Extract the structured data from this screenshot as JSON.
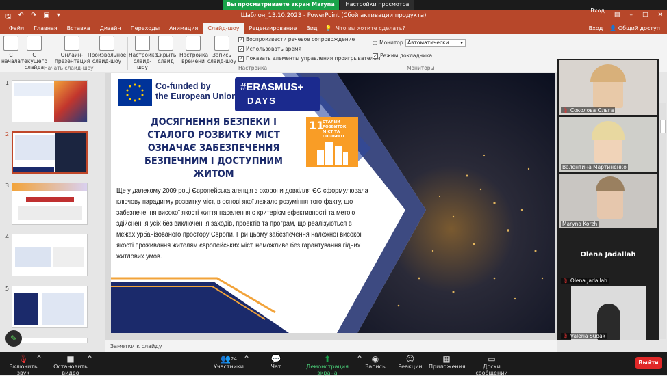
{
  "zoom_top": {
    "share_banner": "Вы просматриваете экран Maryna Korzh",
    "view_settings": "Настройки просмотра"
  },
  "titlebar": {
    "title": "Шаблон_13.10.2023 - PowerPoint (Сбой активации продукта)",
    "signin": "Вход"
  },
  "ribbon_tabs": [
    "Файл",
    "Главная",
    "Вставка",
    "Дизайн",
    "Переходы",
    "Анимация",
    "Слайд-шоу",
    "Рецензирование",
    "Вид"
  ],
  "active_tab": "Слайд-шоу",
  "tell_me": "Что вы хотите сделать?",
  "ribbon_right": {
    "login": "Вход",
    "share": "Общий доступ"
  },
  "ribbon": {
    "start_group": {
      "label": "Начать слайд-шоу",
      "buttons": [
        "С начала",
        "С текущего слайда",
        "Онлайн-презентация",
        "Произвольное слайд-шоу"
      ]
    },
    "setup_group": {
      "label": "Настройка",
      "buttons": [
        "Настройка слайд-шоу",
        "Скрыть слайд",
        "Настройка времени",
        "Запись слайд-шоу"
      ],
      "checks": [
        {
          "label": "Воспроизвести речевое сопровождение",
          "checked": true
        },
        {
          "label": "Использовать время",
          "checked": true
        },
        {
          "label": "Показать элементы управления проигрывателем",
          "checked": true
        }
      ]
    },
    "monitors_group": {
      "label": "Мониторы",
      "monitor_label": "Монитор:",
      "monitor_value": "Автоматически",
      "presenter_view": "Режим докладчика"
    }
  },
  "slide_numbers": [
    "1",
    "2",
    "3",
    "4",
    "5"
  ],
  "selected_slide": 2,
  "slide": {
    "eu_line1": "Co-funded by",
    "eu_line2": "the European Union",
    "erasmus": "#ERASMUS+",
    "days": "DAYS",
    "sdg_num": "11",
    "sdg_text": "СТАЛИЙ РОЗВИТОК МІСТ ТА СПІЛЬНОТ",
    "headline": "ДОСЯГНЕННЯ БЕЗПЕКИ І СТАЛОГО РОЗВИТКУ МІСТ ОЗНАЧАЄ ЗАБЕЗПЕЧЕННЯ БЕЗПЕЧНИМ І ДОСТУПНИМ ЖИТОМ",
    "body": "Ще у далекому 2009 році Європейська агенція з охорони довкілля ЄС сформулювала ключову парадигму розвитку міст, в основі якої лежало розуміння того факту, що забезпечення високої якості життя населення є критерієм ефективності та метою здійснення усіх без виключення заходів, проектів та програм, що реалізуються в межах урбанізованого простору Європи. При цьому забезпечення належної високої якості проживання жителям європейських міст, неможливе без гарантування гідних житлових умов."
  },
  "notes_placeholder": "Заметки к слайду",
  "participants": [
    {
      "name": "Соколова Ольга"
    },
    {
      "name": "Валентина Мартиненко"
    },
    {
      "name": "Maryna Korzh"
    },
    {
      "name": "Olena Jadallah",
      "big_name": "Olena Jadallah"
    },
    {
      "name": "Valeria Sudak"
    }
  ],
  "zoom_bottom": {
    "mute": "Включить звук",
    "video": "Остановить видео",
    "participants": "Участники",
    "participants_count": "24",
    "chat": "Чат",
    "share": "Демонстрация экрана",
    "record": "Запись",
    "reactions": "Реакции",
    "apps": "Приложения",
    "whiteboards": "Доски сообщений",
    "leave": "Выйти"
  },
  "colors": {
    "ppt_accent": "#b7472a",
    "zoom_green": "#1aa34a",
    "leave_red": "#e02828",
    "slide_navy": "#1b2a6b",
    "sdg_orange": "#f99d26"
  }
}
